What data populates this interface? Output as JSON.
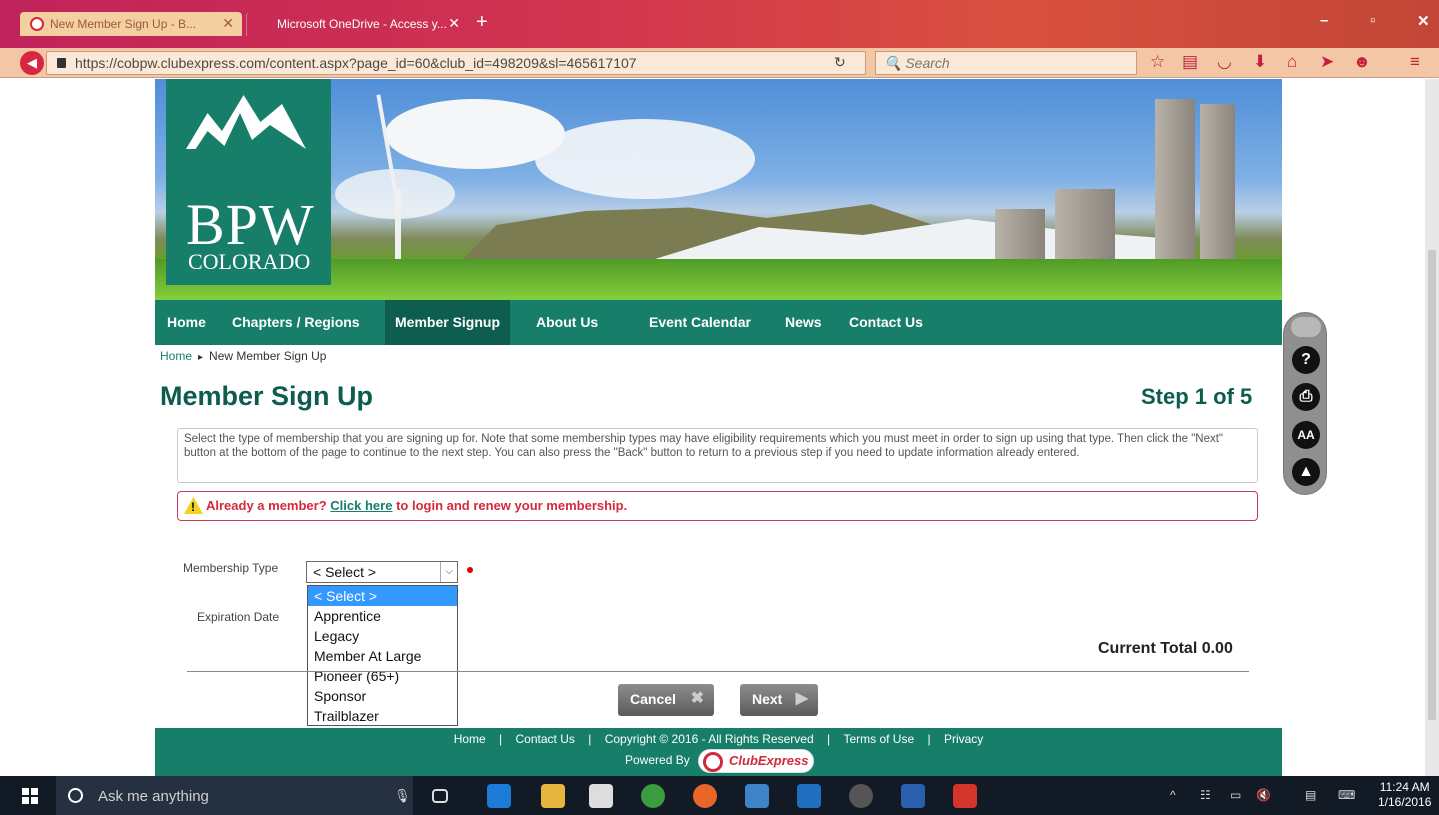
{
  "browser": {
    "tabs": [
      {
        "label": "New Member Sign Up - B...",
        "active": true
      },
      {
        "label": "Microsoft OneDrive - Access y...",
        "active": false
      }
    ],
    "url": "https://cobpw.clubexpress.com/content.aspx?page_id=60&club_id=498209&sl=465617107",
    "search_placeholder": "Search",
    "toolbar_icons": [
      "star-icon",
      "reading-list-icon",
      "pocket-icon",
      "download-icon",
      "home-icon",
      "send-icon",
      "chat-icon",
      "menu-icon"
    ]
  },
  "logo": {
    "title": "BPW",
    "subtitle": "COLORADO"
  },
  "site_nav": [
    "Home",
    "Chapters / Regions",
    "Member Signup",
    "About Us",
    "Event Calendar",
    "News",
    "Contact Us"
  ],
  "breadcrumb": {
    "home": "Home",
    "current": "New Member Sign Up"
  },
  "page": {
    "title": "Member Sign Up",
    "step": "Step 1 of 5",
    "instructions": "Select the type of membership that you are signing up for. Note that some membership types may have eligibility requirements which you must meet in order to sign up using that type. Then click the \"Next\" button at the bottom of the page to continue to the next step. You can also press the \"Back\" button to return to a previous step if you need to update information already entered.",
    "alert_prefix": "Already a member?",
    "alert_link": "Click here",
    "alert_suffix": "to login and renew your membership."
  },
  "form": {
    "membership_type_label": "Membership Type",
    "expiration_date_label": "Expiration Date",
    "selected": "< Select >",
    "options": [
      "< Select >",
      "Apprentice",
      "Legacy",
      "Member At Large",
      "Pioneer (65+)",
      "Sponsor",
      "Trailblazer"
    ],
    "current_total": "Current Total 0.00",
    "cancel": "Cancel",
    "next": "Next"
  },
  "footer": {
    "links": [
      "Home",
      "|",
      "Contact Us",
      "|",
      "Copyright © 2016 - All Rights Reserved",
      "|",
      "Terms of Use",
      "|",
      "Privacy"
    ],
    "powered_by": "Powered By",
    "brand": "ClubExpress"
  },
  "taskbar": {
    "search_text": "Ask me anything",
    "time": "11:24 AM",
    "date": "1/16/2016"
  },
  "colors": {
    "brand_green": "#177e6a",
    "title_green": "#0d5d4f",
    "alert_red": "#d42a3a"
  }
}
